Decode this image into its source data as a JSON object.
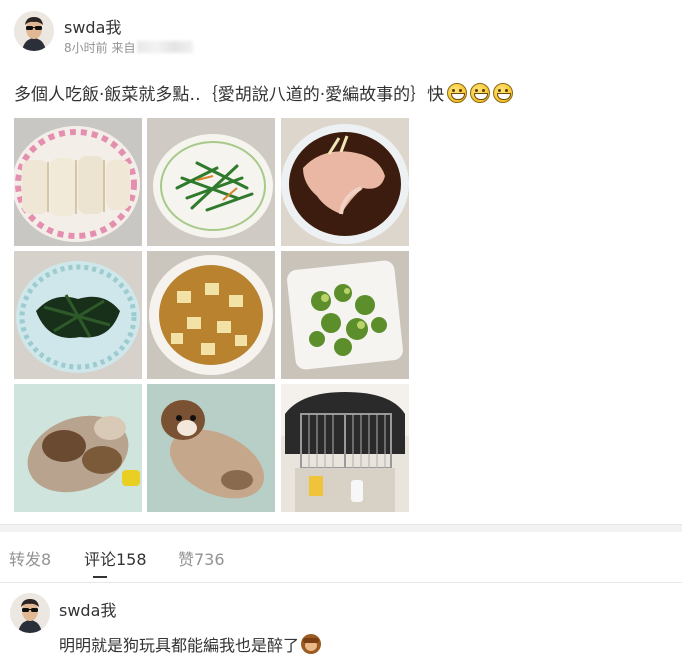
{
  "post": {
    "username": "swda我",
    "time": "8小时前",
    "source_prefix": "来自",
    "text": "多個人吃飯·飯菜就多點‥｛愛胡說八道的·愛編故事的｝快",
    "emoji": [
      "grin-emoji",
      "grin-emoji",
      "grin-emoji"
    ],
    "photos": [
      {
        "name": "photo-rice-rolls"
      },
      {
        "name": "photo-green-vegetable-stir-fry"
      },
      {
        "name": "photo-steamed-salmon"
      },
      {
        "name": "photo-dark-greens"
      },
      {
        "name": "photo-mapo-tofu"
      },
      {
        "name": "photo-brussels-sprouts"
      },
      {
        "name": "photo-sleeping-puppy"
      },
      {
        "name": "photo-puppy-on-back"
      },
      {
        "name": "photo-bird-cages"
      }
    ]
  },
  "tabs": {
    "repost": "转发8",
    "comment": "评论158",
    "like": "赞736"
  },
  "comment": {
    "username": "swda我",
    "text": "明明就是狗玩具都能編我也是醉了",
    "emoji": "see-no-evil-monkey-emoji"
  },
  "colors": {
    "text_primary": "#333333",
    "text_secondary": "#939393",
    "divider": "#f2f2f2"
  }
}
